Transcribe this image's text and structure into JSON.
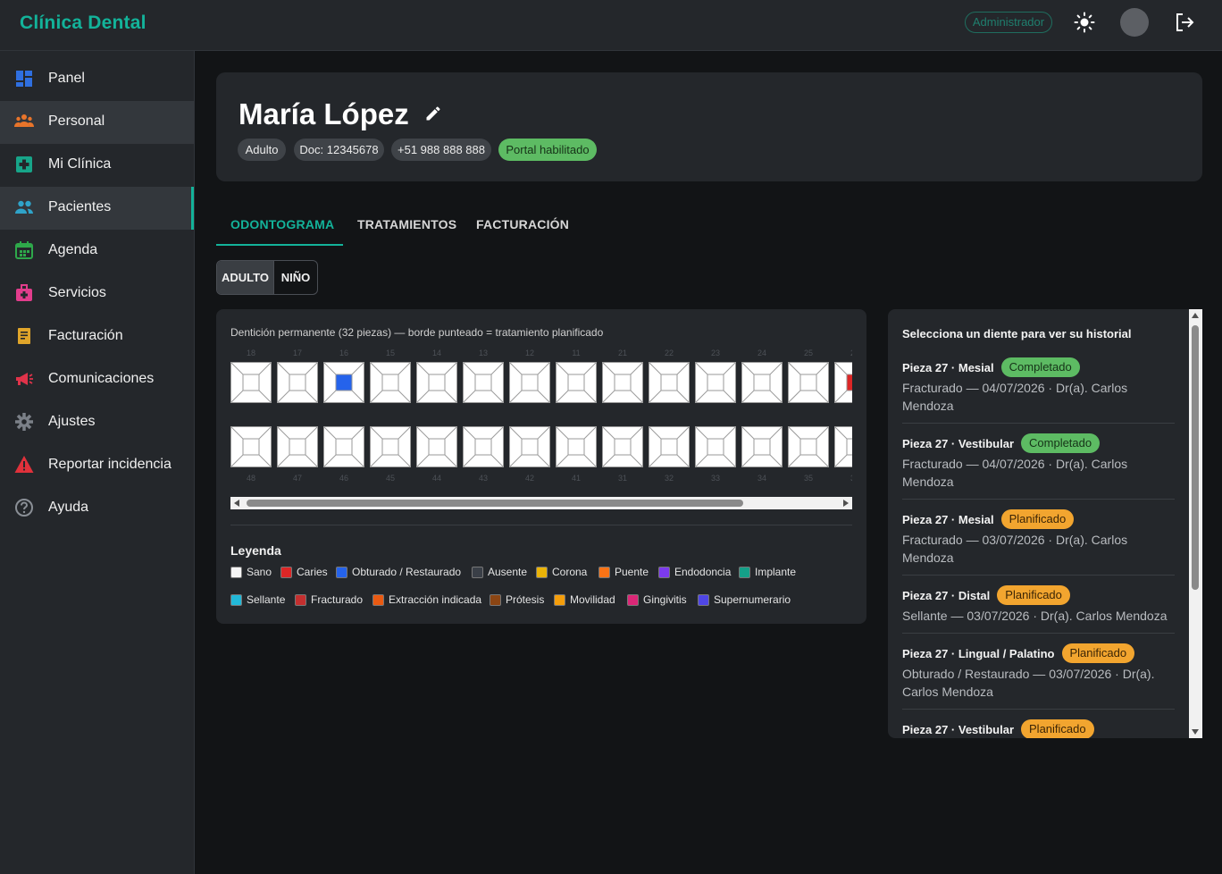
{
  "app": {
    "brand": "Clínica Dental",
    "role": "Administrador"
  },
  "sidebar": {
    "items": [
      {
        "label": "Panel",
        "icon": "dashboard-icon",
        "color": "#2f6fe0"
      },
      {
        "label": "Personal",
        "icon": "people-icon",
        "color": "#e8742a"
      },
      {
        "label": "Mi Clínica",
        "icon": "medical-plus-icon",
        "color": "#17a589"
      },
      {
        "label": "Pacientes",
        "icon": "patients-icon",
        "color": "#2fa3c9"
      },
      {
        "label": "Agenda",
        "icon": "calendar-icon",
        "color": "#2ea84a"
      },
      {
        "label": "Servicios",
        "icon": "medkit-icon",
        "color": "#e23d8c"
      },
      {
        "label": "Facturación",
        "icon": "receipt-icon",
        "color": "#e0a52a"
      },
      {
        "label": "Comunicaciones",
        "icon": "megaphone-icon",
        "color": "#e0334a"
      },
      {
        "label": "Ajustes",
        "icon": "gear-icon",
        "color": "#7b8088"
      },
      {
        "label": "Reportar incidencia",
        "icon": "warning-icon",
        "color": "#e0313b"
      },
      {
        "label": "Ayuda",
        "icon": "help-icon",
        "color": "#8a8f96"
      }
    ]
  },
  "patient": {
    "name": "María López",
    "chips": [
      "Adulto",
      "Doc: 12345678",
      "+51 988 888 888",
      "Portal habilitado"
    ]
  },
  "tabs": [
    "ODONTOGRAMA",
    "TRATAMIENTOS",
    "FACTURACIÓN"
  ],
  "toggle": {
    "adult": "ADULTO",
    "child": "NIÑO"
  },
  "odontogram": {
    "caption": "Dentición permanente (32 piezas) — borde punteado = tratamiento planificado",
    "upper": [
      "18",
      "17",
      "16",
      "15",
      "14",
      "13",
      "12",
      "11",
      "21",
      "22",
      "23",
      "24",
      "25",
      "26"
    ],
    "lower": [
      "48",
      "47",
      "46",
      "45",
      "44",
      "43",
      "42",
      "41",
      "31",
      "32",
      "33",
      "34",
      "35",
      "36"
    ],
    "marked": {
      "16": "#2563eb",
      "26": "#dc2626"
    },
    "legend_title": "Leyenda",
    "legend": [
      {
        "label": "Sano",
        "color": "#f5f5f5"
      },
      {
        "label": "Caries",
        "color": "#dc2626"
      },
      {
        "label": "Obturado / Restaurado",
        "color": "#2563eb"
      },
      {
        "label": "Ausente",
        "color": "#3a3f47"
      },
      {
        "label": "Corona",
        "color": "#eab308"
      },
      {
        "label": "Puente",
        "color": "#f97316"
      },
      {
        "label": "Endodoncia",
        "color": "#7c3aed"
      },
      {
        "label": "Implante",
        "color": "#14a088"
      },
      {
        "label": "Sellante",
        "color": "#22b8d8"
      },
      {
        "label": "Fracturado",
        "color": "#c42f2f"
      },
      {
        "label": "Extracción indicada",
        "color": "#ea5a12"
      },
      {
        "label": "Prótesis",
        "color": "#8b4513"
      },
      {
        "label": "Movilidad",
        "color": "#f59e0b"
      },
      {
        "label": "Gingivitis",
        "color": "#db2777"
      },
      {
        "label": "Supernumerario",
        "color": "#4f46e5"
      }
    ]
  },
  "history": {
    "title": "Selecciona un diente para ver su historial",
    "entries": [
      {
        "title": "Pieza 27 · Mesial",
        "status": "Completado",
        "kind": "done",
        "desc": "Fracturado — 04/07/2026 · Dr(a). Carlos Mendoza"
      },
      {
        "title": "Pieza 27 · Vestibular",
        "status": "Completado",
        "kind": "done",
        "desc": "Fracturado — 04/07/2026 · Dr(a). Carlos Mendoza"
      },
      {
        "title": "Pieza 27 · Mesial",
        "status": "Planificado",
        "kind": "plan",
        "desc": "Fracturado — 03/07/2026 · Dr(a). Carlos Mendoza"
      },
      {
        "title": "Pieza 27 · Distal",
        "status": "Planificado",
        "kind": "plan",
        "desc": "Sellante — 03/07/2026 · Dr(a). Carlos Mendoza"
      },
      {
        "title": "Pieza 27 · Lingual / Palatino",
        "status": "Planificado",
        "kind": "plan",
        "desc": "Obturado / Restaurado — 03/07/2026 · Dr(a). Carlos Mendoza"
      },
      {
        "title": "Pieza 27 · Vestibular",
        "status": "Planificado",
        "kind": "plan",
        "desc": ""
      }
    ]
  }
}
